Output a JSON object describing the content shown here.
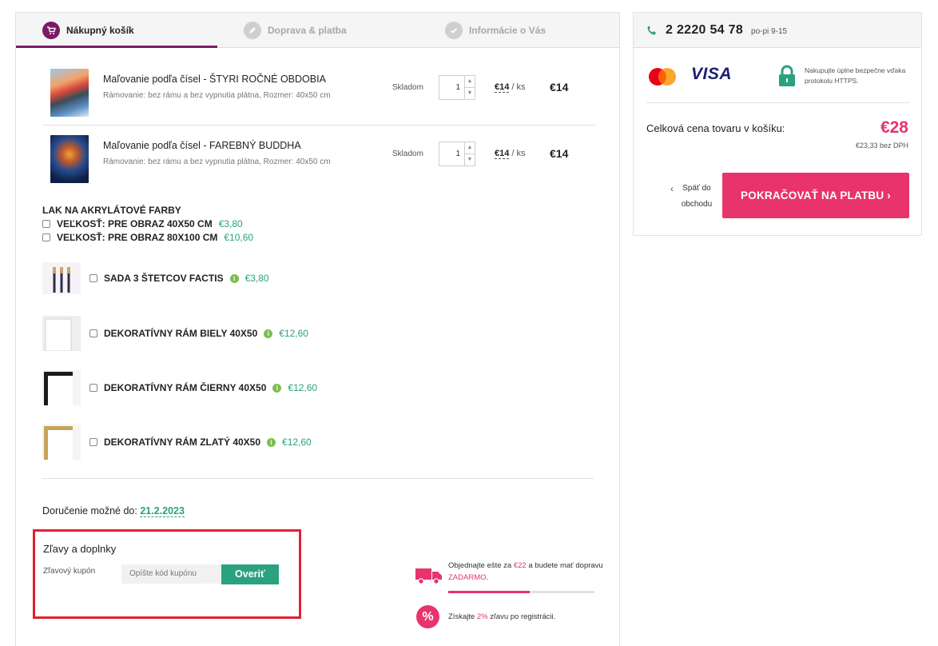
{
  "steps": [
    {
      "label": "Nákupný košík",
      "active": true
    },
    {
      "label": "Doprava & platba",
      "active": false
    },
    {
      "label": "Informácie o Vás",
      "active": false
    }
  ],
  "products": [
    {
      "name": "Maľovanie podľa čísel - ŠTYRI ROČNÉ OBDOBIA",
      "options": "Rámovanie: bez rámu a bez vypnutia plátna, Rozmer: 40x50 cm",
      "stock": "Skladom",
      "quantity": "1",
      "unit_price": "€14",
      "unit_suffix": " / ks",
      "total": "€14",
      "image": "tree-painting-thumbnail"
    },
    {
      "name": "Maľovanie podľa čísel - FAREBNÝ BUDDHA",
      "options": "Rámovanie: bez rámu a bez vypnutia plátna, Rozmer: 40x50 cm",
      "stock": "Skladom",
      "quantity": "1",
      "unit_price": "€14",
      "unit_suffix": " / ks",
      "total": "€14",
      "image": "buddha-painting-thumbnail"
    }
  ],
  "lak": {
    "title": "LAK NA AKRYLÁTOVÉ FARBY",
    "options": [
      {
        "label": "VEĽKOSŤ: PRE OBRAZ 40X50 CM",
        "price": "€3,80"
      },
      {
        "label": "VEĽKOSŤ: PRE OBRAZ 80X100 CM",
        "price": "€10,60"
      }
    ]
  },
  "addons": [
    {
      "label": "SADA 3 ŠTETCOV FACTIS",
      "price": "€3,80",
      "image": "brushes-thumbnail"
    },
    {
      "label": "DEKORATÍVNY RÁM BIELY 40X50",
      "price": "€12,60",
      "image": "white-frame-thumbnail"
    },
    {
      "label": "DEKORATÍVNY RÁM ČIERNY 40X50",
      "price": "€12,60",
      "image": "black-frame-thumbnail"
    },
    {
      "label": "DEKORATÍVNY RÁM ZLATÝ 40X50",
      "price": "€12,60",
      "image": "gold-frame-thumbnail"
    }
  ],
  "delivery": {
    "label": "Doručenie možné do:",
    "date": "21.2.2023"
  },
  "discount": {
    "title": "Zľavy a doplnky",
    "coupon_label": "Zľavový kupón",
    "coupon_placeholder": "Opíšte kód kupónu",
    "verify_label": "Overiť"
  },
  "free_shipping": {
    "before": "Objednajte ešte za ",
    "amount": "€22",
    "middle": " a budete mať dopravu ",
    "free": "ZADARMO",
    "after": ".",
    "progress": 0.56
  },
  "registration": {
    "before": "Získajte ",
    "percent": "2%",
    "after": " zľavu po registrácii."
  },
  "contact": {
    "phone": "2 2220 54 78",
    "hours": "po-pi 9-15"
  },
  "payment": {
    "visa_label": "VISA",
    "secure_text": "Nakupujte úplne bezpečne vďaka protokolu HTTPS."
  },
  "summary": {
    "total_label": "Celková cena tovaru v košíku:",
    "total_price": "€28",
    "total_net": "€23,33 bez DPH",
    "back_label": "Späť do obchodu",
    "continue_label": "POKRAČOVAŤ NA PLATBU"
  },
  "colors": {
    "brand_purple": "#7c1a63",
    "accent_green": "#2aa27f",
    "accent_pink": "#e8336c",
    "highlight_red": "#e0202e"
  }
}
